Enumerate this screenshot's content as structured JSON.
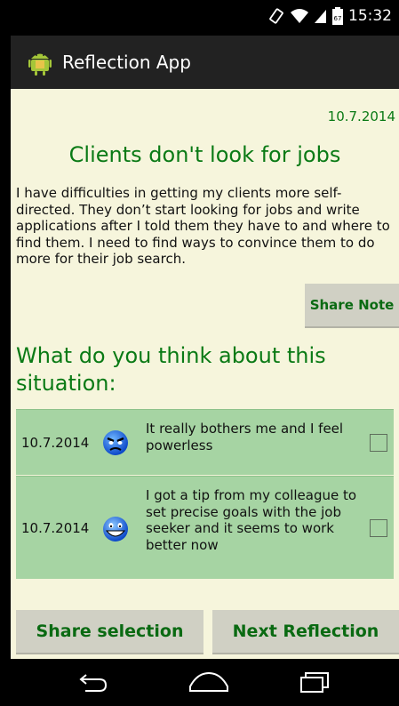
{
  "status_bar": {
    "time": "15:32",
    "icons": [
      "rotation-icon",
      "wifi-icon",
      "signal-icon",
      "battery-icon"
    ],
    "battery_level": "67"
  },
  "action_bar": {
    "title": "Reflection App",
    "icon": "android-app-icon"
  },
  "note": {
    "date": "10.7.2014",
    "title": "Clients don't look for jobs",
    "body": "I have difficulties in getting my clients more self-directed. They don’t start looking for jobs and write applications after I told them they have to and where to find them. I need to find ways to convince them to do more for their job search.",
    "share_label": "Share Note"
  },
  "question": "What do you think about this situation:",
  "reflections": [
    {
      "date": "10.7.2014",
      "mood_icon": "angry-face-icon",
      "text": "It really bothers me and I feel powerless",
      "checked": false
    },
    {
      "date": "10.7.2014",
      "mood_icon": "smiling-face-icon",
      "text": "I got a tip from my colleague to set precise goals with the job seeker and it seems to work better now",
      "checked": false
    }
  ],
  "buttons": {
    "share_selection": "Share selection",
    "next_reflection": "Next Reflection"
  },
  "colors": {
    "accent_green": "#0a7a15",
    "content_bg": "#f6f5dc",
    "list_bg": "#a6d4a3",
    "button_bg": "#d0d0c4"
  }
}
